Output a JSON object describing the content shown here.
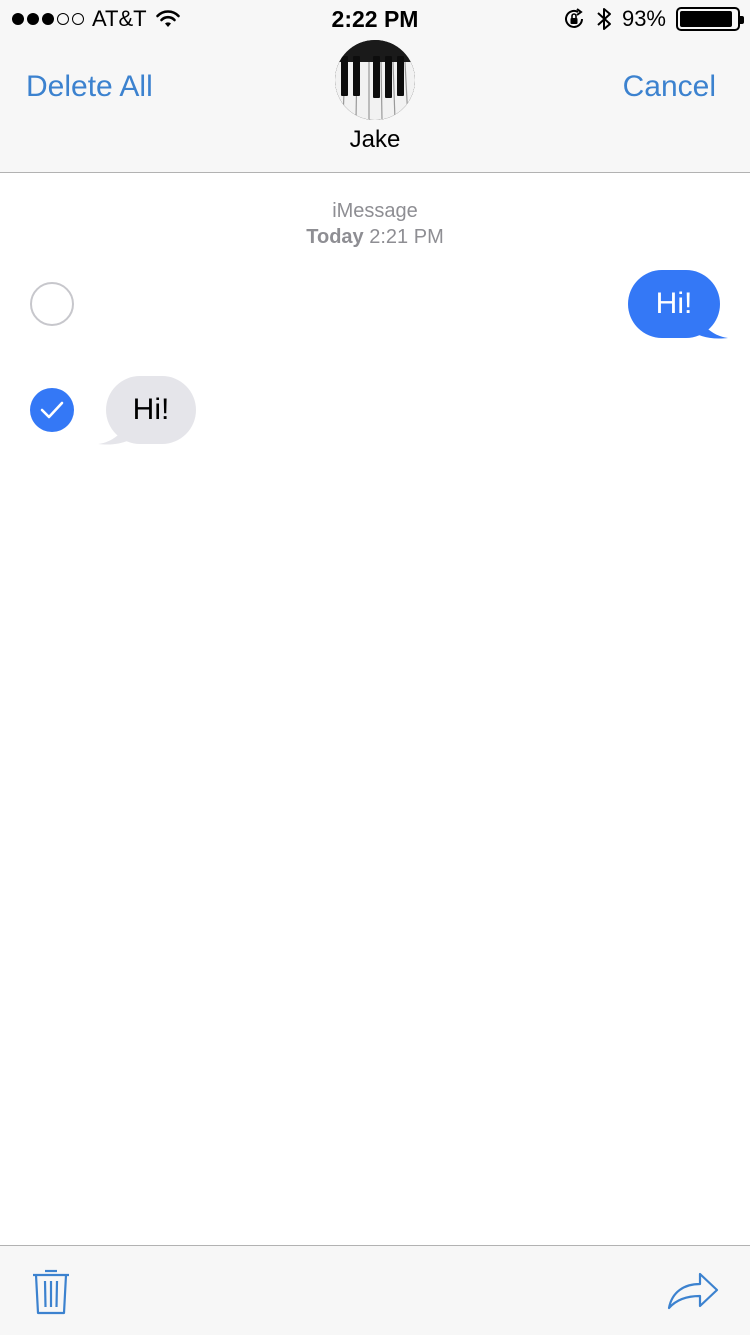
{
  "status": {
    "carrier": "AT&T",
    "time": "2:22 PM",
    "battery": "93%",
    "battery_level": 0.93,
    "signal_bars_filled": 3,
    "signal_bars_total": 5
  },
  "header": {
    "left_button": "Delete All",
    "right_button": "Cancel",
    "contact_name": "Jake",
    "avatar_icon": "piano-keys-avatar"
  },
  "conversation": {
    "service": "iMessage",
    "day": "Today",
    "time": "2:21 PM"
  },
  "messages": [
    {
      "text": "Hi!",
      "direction": "outgoing",
      "selected": false
    },
    {
      "text": "Hi!",
      "direction": "incoming",
      "selected": true
    }
  ],
  "toolbar": {
    "delete_icon": "trash-icon",
    "forward_icon": "forward-arrow-icon"
  },
  "colors": {
    "accent": "#3c82cf",
    "outgoing_bubble": "#3478f6",
    "incoming_bubble": "#e5e5ea",
    "meta_text": "#8e8e93"
  }
}
